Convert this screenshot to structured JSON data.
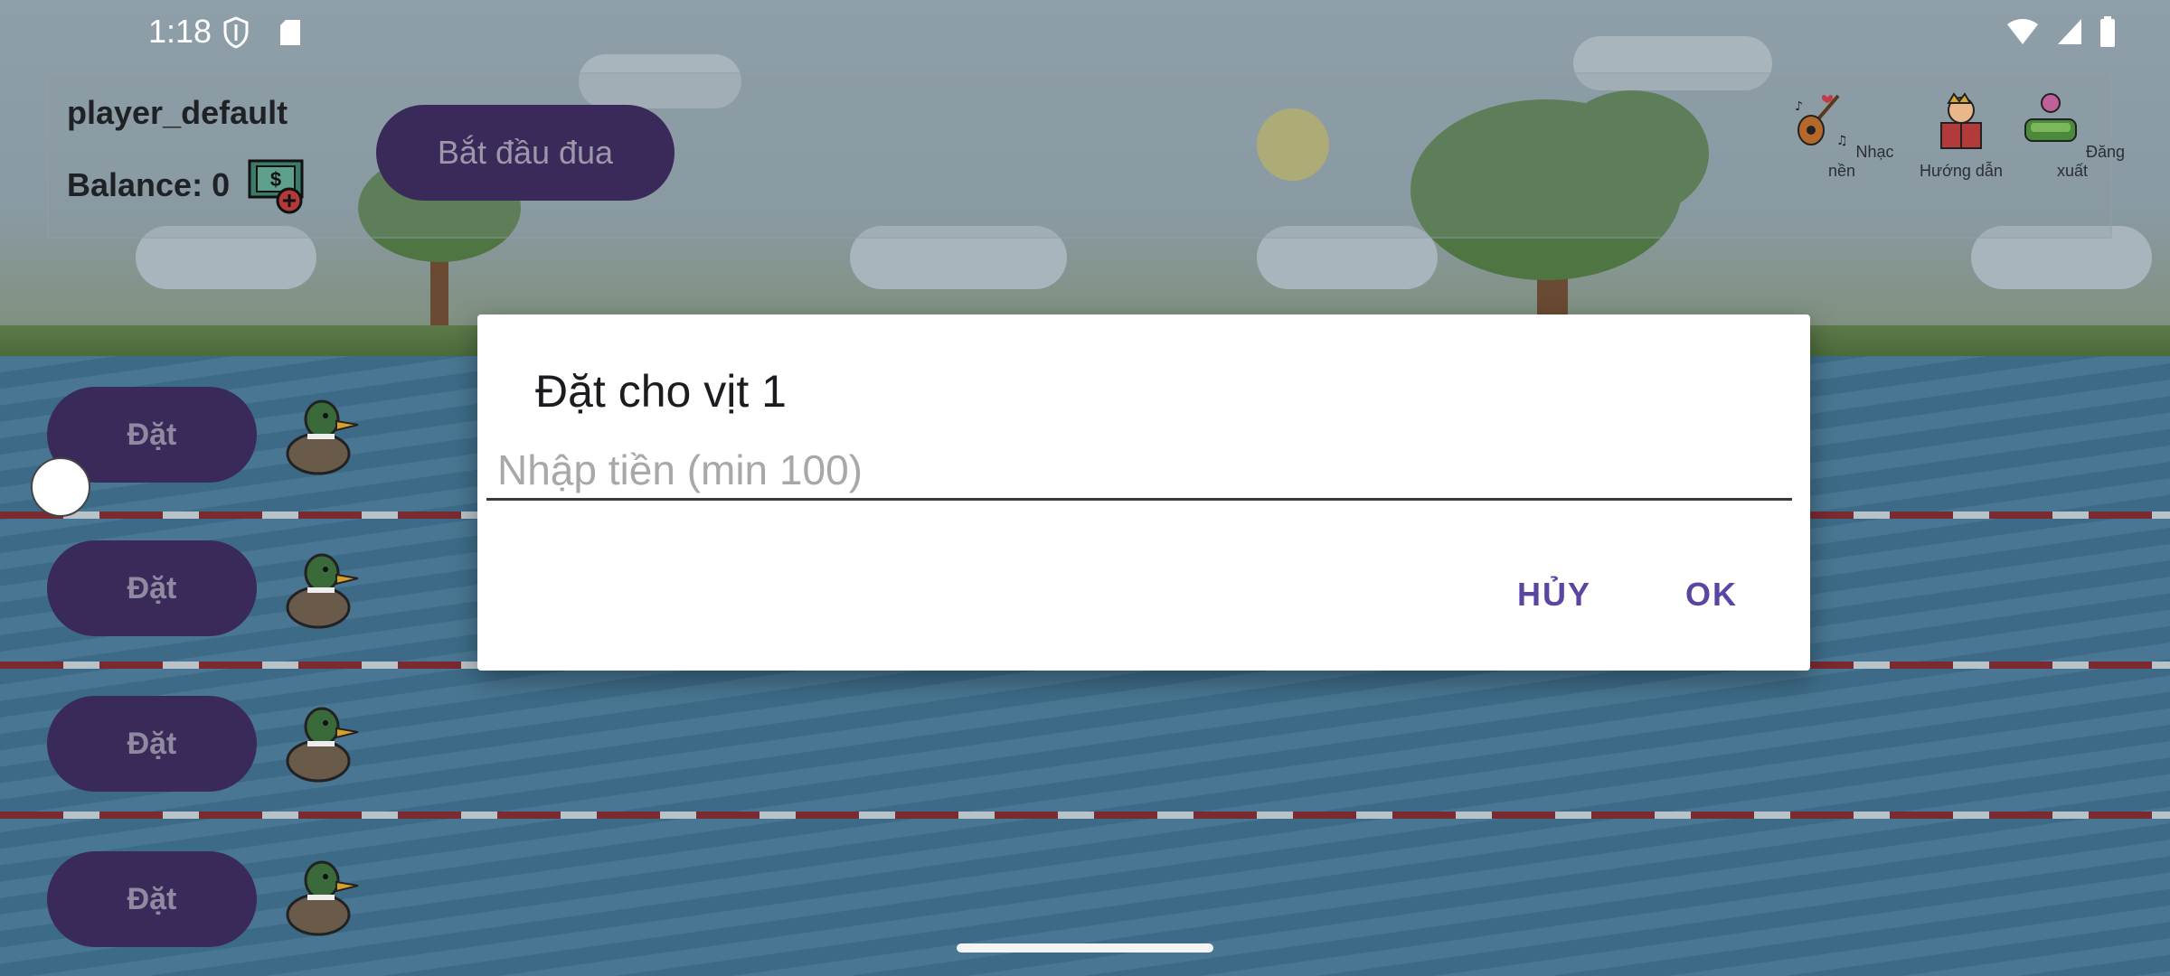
{
  "status_bar": {
    "time": "1:18",
    "icons": [
      "shield-icon",
      "sd-card-icon",
      "wifi-icon",
      "cellular-icon",
      "battery-icon"
    ]
  },
  "header": {
    "player_name": "player_default",
    "balance_label": "Balance: 0",
    "start_button": "Bắt đầu đua",
    "menu": [
      {
        "icon": "guitar-music-icon",
        "label": "Nhạc nền"
      },
      {
        "icon": "reading-guide-icon",
        "label": "Hướng dẫn"
      },
      {
        "icon": "logout-icon",
        "label": "Đăng xuất"
      }
    ]
  },
  "lanes": [
    {
      "bet_label": "Đặt"
    },
    {
      "bet_label": "Đặt"
    },
    {
      "bet_label": "Đặt"
    },
    {
      "bet_label": "Đặt"
    }
  ],
  "dialog": {
    "title": "Đặt cho vịt 1",
    "input_placeholder": "Nhập tiền (min 100)",
    "input_value": "",
    "cancel_label": "HỦY",
    "ok_label": "OK"
  },
  "colors": {
    "button_bg": "#3a2a5a",
    "dialog_accent": "#5a46a0",
    "water": "#3f6f8c"
  }
}
